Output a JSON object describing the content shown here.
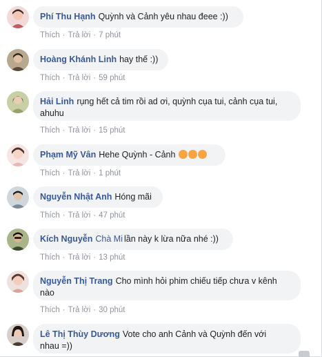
{
  "comments": [
    {
      "name": "Phí Thu Hạnh",
      "text": "Quỳnh và Cảnh yêu nhau đeee :))",
      "like": "Thích",
      "reply": "Trả lời",
      "time": "7 phút",
      "avatar_color": "#c45a63"
    },
    {
      "name": "Hoàng Khánh Linh",
      "text": "hay thế :))",
      "like": "Thích",
      "reply": "Trả lời",
      "time": "59 phút",
      "avatar_color": "#5a4a3c"
    },
    {
      "name": "Hải Linh",
      "text_line1": "rụng hết cả tim rồi ad ơi, quỳnh cụa tui, cảnh cụa tui,",
      "text_line2": "ahuhu",
      "like": "Thích",
      "reply": "Trả lời",
      "time": "15 phút",
      "avatar_color": "#9aa06a"
    },
    {
      "name": "Phạm Mỹ Vân",
      "text": "Hehe Quỳnh - Cảnh",
      "emoji": [
        "heart-eyes",
        "heart-eyes",
        "heart-eyes"
      ],
      "like": "Thích",
      "reply": "Trả lời",
      "time": "1 phút",
      "avatar_color": "#e7b9b4"
    },
    {
      "name": "Nguyễn Nhật Anh",
      "text": "Hóng mãi",
      "like": "Thích",
      "reply": "Trả lời",
      "time": "47 phút",
      "avatar_color": "#7d8a96"
    },
    {
      "name": "Kích Nguyễn",
      "tag": "Chà Mi",
      "text": "lần này k lừa nữa nhé :))",
      "like": "Thích",
      "reply": "Trả lời",
      "time": "13 phút",
      "avatar_color": "#3e4a2c"
    },
    {
      "name": "Nguyễn Thị Trang",
      "text_line1": "Cho mình hỏi phim chiếu tiếp chưa v kênh",
      "text_line2": "nào",
      "like": "Thích",
      "reply": "Trả lời",
      "time": "30 phút",
      "avatar_color": "#d9a49a"
    },
    {
      "name": "Lê Thị Thùy Dương",
      "text_line1": "Vote cho anh Cảnh và Quỳnh đến với",
      "text_line2": "nhau =))",
      "avatar_color": "#4b3a33"
    }
  ],
  "colors": {
    "name": "#385898",
    "bubble": "#f2f3f5",
    "meta": "#90949c"
  }
}
